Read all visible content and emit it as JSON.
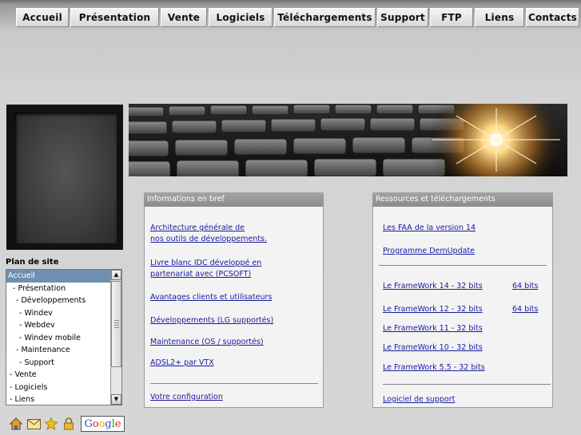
{
  "nav": {
    "tabs": [
      "Accueil",
      "Présentation",
      "Vente",
      "Logiciels",
      "Téléchargements",
      "Support",
      "FTP",
      "Liens",
      "Contacts"
    ]
  },
  "sitemap": {
    "title": "Plan de site",
    "items": [
      {
        "label": "Accueil",
        "selected": true
      },
      {
        "label": "  - Présentation"
      },
      {
        "label": "    - Développements"
      },
      {
        "label": "       - Windev"
      },
      {
        "label": "       - Webdev"
      },
      {
        "label": "       - Windev mobile"
      },
      {
        "label": "    - Maintenance"
      },
      {
        "label": "       - Support"
      },
      {
        "label": "  - Vente"
      },
      {
        "label": "  - Logiciels"
      },
      {
        "label": "  - Liens"
      }
    ],
    "scroll_up": "▲",
    "scroll_down": "▼"
  },
  "footer_icons": [
    "home-icon",
    "mail-icon",
    "favorite-star-icon",
    "lock-icon"
  ],
  "google_button": {
    "letters": [
      "G",
      "o",
      "o",
      "g",
      "l",
      "e"
    ],
    "colors": [
      "#2a55c8",
      "#d0281e",
      "#e8a800",
      "#2a55c8",
      "#1a9a2a",
      "#d0281e"
    ]
  },
  "info_panel": {
    "title": "Informations en bref",
    "links": [
      "Architecture générale de",
      "nos outils de développements.",
      "Livre blanc IDC développé en",
      "partenariat avec (PCSOFT)",
      "Avantages clients et utilisateurs",
      "Développements (LG supportés)",
      "Maintenance (OS / supportés)",
      "ADSL2+ par VTX",
      "Votre configuration"
    ]
  },
  "resources_panel": {
    "title": "Ressources et téléchargements",
    "links": [
      "Les FAA de la version 14",
      "Programme DemUpdate",
      "Le FrameWork 14 - 32 bits",
      "64 bits",
      "Le FrameWork 12 - 32 bits",
      "64 bits",
      "Le FrameWork 11 - 32 bits",
      "Le FrameWork 10 - 32 bits",
      "Le FrameWork 5.5 - 32 bits",
      "Logiciel de support"
    ]
  },
  "colors": {
    "link": "#1a1aa0",
    "panel_header": "#999999",
    "selected": "#6f8fb0"
  }
}
